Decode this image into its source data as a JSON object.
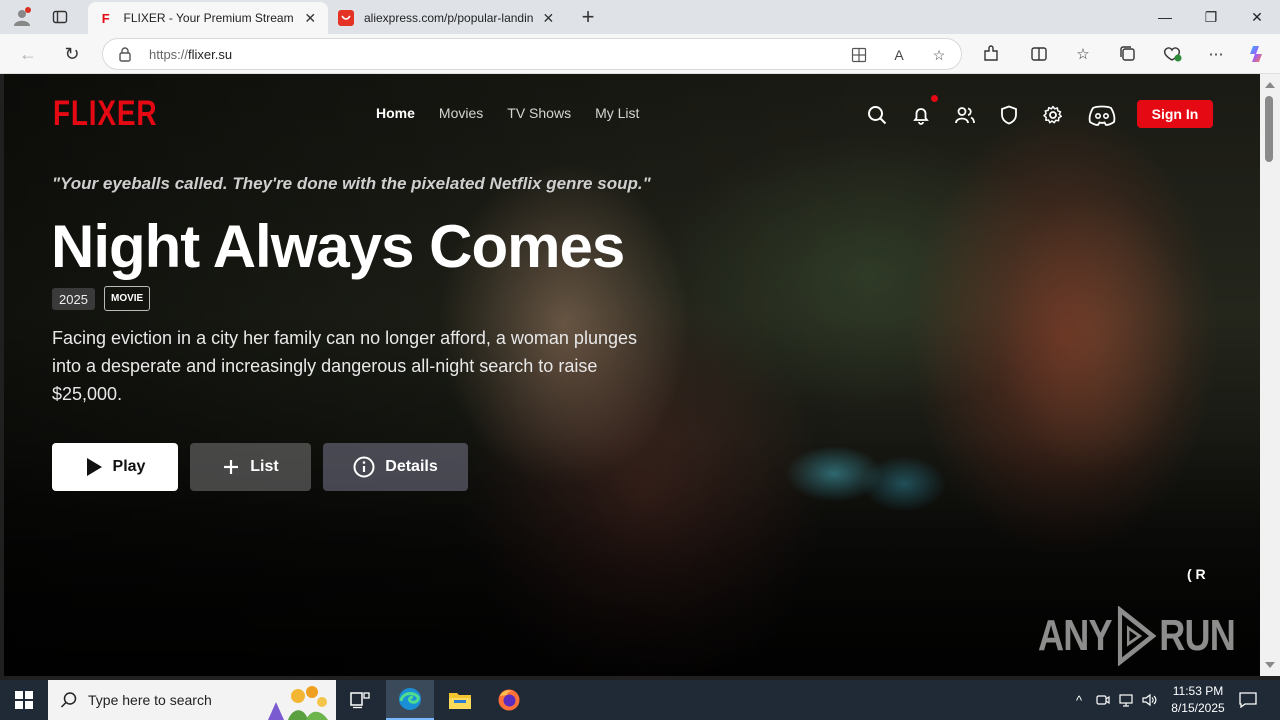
{
  "browser": {
    "tabs": [
      {
        "title": "FLIXER - Your Premium Streaming",
        "favicon": "F",
        "active": true
      },
      {
        "title": "aliexpress.com/p/popular-landing",
        "favicon": "ali",
        "active": false
      }
    ],
    "url_scheme": "https://",
    "url_host": "flixer.su"
  },
  "site": {
    "logo": "FLIXER",
    "nav": [
      "Home",
      "Movies",
      "TV Shows",
      "My List"
    ],
    "sign_in": "Sign In",
    "accent": "#e50914"
  },
  "hero": {
    "tagline": "\"Your eyeballs called. They're done with the pixelated Netflix genre soup.\"",
    "title": "Night Always Comes",
    "year": "2025",
    "type": "MOVIE",
    "synopsis": "Facing eviction in a city her family can no longer afford, a woman plunges into a desperate and increasingly dangerous all-night search to raise $25,000.",
    "buttons": {
      "play": "Play",
      "list": "List",
      "details": "Details"
    },
    "rating_mark": "( R"
  },
  "watermark": {
    "left": "ANY",
    "right": "RUN"
  },
  "taskbar": {
    "search_placeholder": "Type here to search",
    "time": "11:53 PM",
    "date": "8/15/2025"
  }
}
